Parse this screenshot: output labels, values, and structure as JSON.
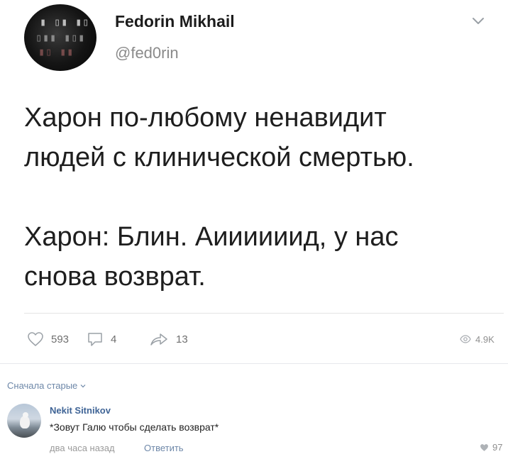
{
  "tweet": {
    "author_name": "Fedorin Mikhail",
    "author_handle": "@fed0rin",
    "text": "Харон по-любому ненавидит\nлюдей с клинической смертью.\n\nХарон: Блин. Аиииииид, у нас\nснова возврат.",
    "icons": {
      "menu": "chevron-down-icon"
    }
  },
  "actions": {
    "likes": "593",
    "comments": "4",
    "reposts": "13",
    "views": "4.9K",
    "icons": [
      "heart-icon",
      "comment-icon",
      "share-icon",
      "eye-icon"
    ]
  },
  "comments_section": {
    "sort_label": "Сначала старые",
    "comment": {
      "author": "Nekit Sitnikov",
      "text": "*Зовут Галю чтобы сделать возврат*",
      "time": "два часа назад",
      "reply_label": "Ответить",
      "likes": "97"
    }
  },
  "colors": {
    "link": "#6d87a8",
    "author_link": "#3f6496",
    "muted": "#8f8f8f"
  }
}
